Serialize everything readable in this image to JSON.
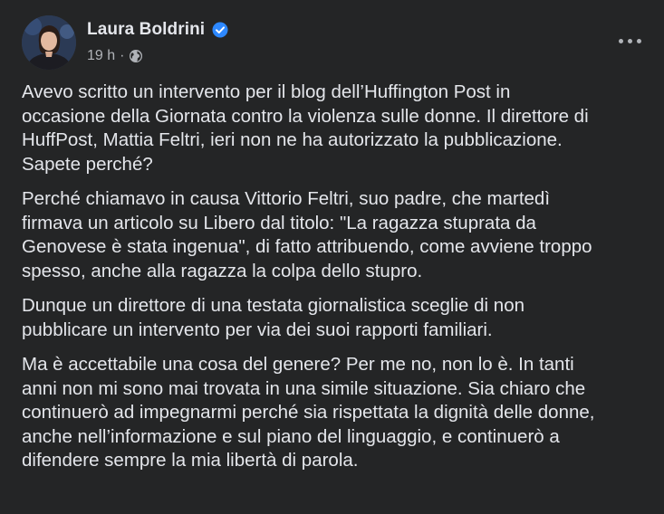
{
  "post": {
    "author": "Laura Boldrini",
    "verified": true,
    "timestamp": "19 h",
    "separator": "·",
    "audience_icon": "globe-icon",
    "more_icon": "more-options-icon",
    "paragraphs": [
      "Avevo scritto un intervento per il blog dell’Huffington Post in\noccasione della Giornata contro la violenza sulle donne. Il direttore di\nHuffPost, Mattia Feltri, ieri non ne ha autorizzato la pubblicazione.\nSapete perché?",
      "Perché chiamavo in causa Vittorio Feltri, suo padre, che martedì\nfirmava un articolo su Libero dal titolo: \"La ragazza stuprata da\nGenovese è stata ingenua\", di fatto attribuendo, come avviene troppo\nspesso, anche alla ragazza la colpa dello stupro.",
      "Dunque un direttore di una testata giornalistica sceglie di non\npubblicare un intervento per via dei suoi rapporti familiari.",
      "Ma è accettabile una cosa del genere? Per me no, non lo è. In tanti\nanni non mi sono mai trovata in una simile situazione. Sia chiaro che\ncontinuerò ad impegnarmi perché sia rispettata la dignità delle donne,\nanche nell’informazione e sul piano del linguaggio, e continuerò a\ndifendere sempre la mia libertà di parola."
    ]
  },
  "colors": {
    "background": "#242526",
    "text_primary": "#e4e6eb",
    "text_secondary": "#b0b3b8",
    "verified_badge": "#2d88ff"
  }
}
